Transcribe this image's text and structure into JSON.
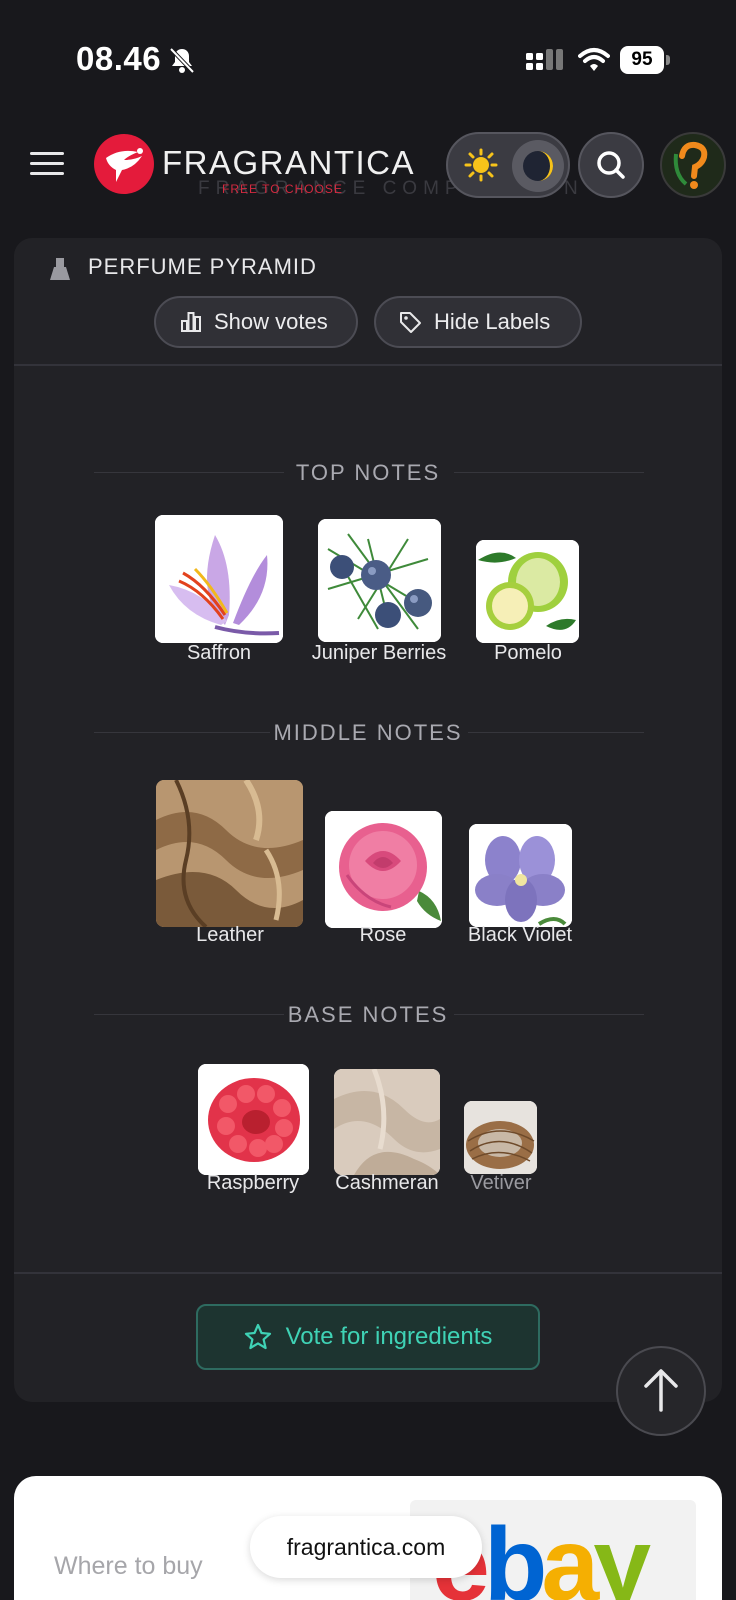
{
  "status_bar": {
    "time": "08.46",
    "battery": "95"
  },
  "header": {
    "brand": "FRAGRANTICA",
    "tagline": "FREE TO CHOOSE",
    "ghost_text": "FRAGRANCE COMPOSITION"
  },
  "pyramid": {
    "title": "PERFUME PYRAMID",
    "show_votes_label": "Show votes",
    "hide_labels_label": "Hide Labels",
    "top": {
      "heading": "TOP NOTES",
      "notes": [
        {
          "name": "Saffron"
        },
        {
          "name": "Juniper Berries"
        },
        {
          "name": "Pomelo"
        }
      ]
    },
    "middle": {
      "heading": "MIDDLE NOTES",
      "notes": [
        {
          "name": "Leather"
        },
        {
          "name": "Rose"
        },
        {
          "name": "Black Violet"
        }
      ]
    },
    "base": {
      "heading": "BASE NOTES",
      "notes": [
        {
          "name": "Raspberry"
        },
        {
          "name": "Cashmeran"
        },
        {
          "name": "Vetiver"
        }
      ]
    },
    "vote_button_label": "Vote for ingredients"
  },
  "where_to_buy": {
    "label": "Where to buy",
    "store": "ebay"
  },
  "browser": {
    "url": "fragrantica.com"
  },
  "colors": {
    "accent": "#3fd2b5",
    "brand": "#e41b3b",
    "background": "#18181c"
  }
}
